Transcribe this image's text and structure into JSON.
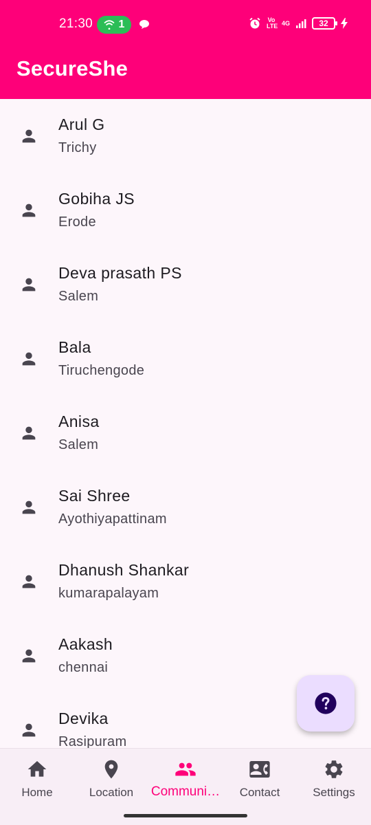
{
  "status_bar": {
    "time": "21:30",
    "hotspot_count": "1",
    "network_label": "4G",
    "volte_label": "Vo LTE",
    "battery": "32"
  },
  "app": {
    "title": "SecureShe",
    "brand_color": "#fe0079"
  },
  "contacts": [
    {
      "name": "Arul G",
      "city": "Trichy"
    },
    {
      "name": "Gobiha JS",
      "city": "Erode"
    },
    {
      "name": "Deva prasath PS",
      "city": "Salem"
    },
    {
      "name": "Bala",
      "city": "Tiruchengode"
    },
    {
      "name": "Anisa",
      "city": "Salem"
    },
    {
      "name": "Sai Shree",
      "city": "Ayothiyapattinam"
    },
    {
      "name": "Dhanush Shankar",
      "city": "kumarapalayam"
    },
    {
      "name": "Aakash",
      "city": "chennai"
    },
    {
      "name": "Devika",
      "city": "Rasipuram"
    }
  ],
  "fab": {
    "icon": "help-icon"
  },
  "bottom_nav": {
    "items": [
      {
        "label": "Home",
        "icon": "home-icon"
      },
      {
        "label": "Location",
        "icon": "location-pin-icon"
      },
      {
        "label": "Communi…",
        "icon": "people-icon",
        "active": true
      },
      {
        "label": "Contact",
        "icon": "contact-card-icon"
      },
      {
        "label": "Settings",
        "icon": "gear-icon"
      }
    ]
  }
}
